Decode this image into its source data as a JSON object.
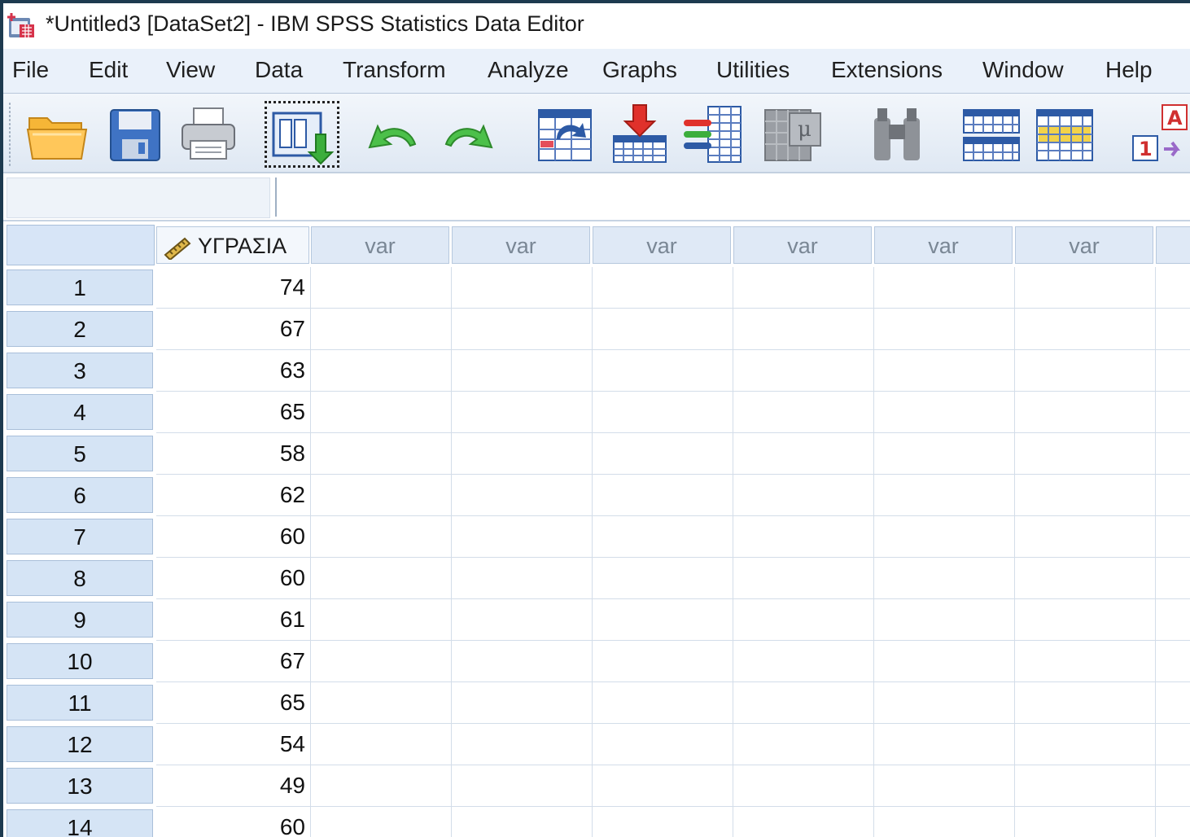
{
  "window": {
    "title": "*Untitled3 [DataSet2] - IBM SPSS Statistics Data Editor"
  },
  "menu": [
    "File",
    "Edit",
    "View",
    "Data",
    "Transform",
    "Analyze",
    "Graphs",
    "Utilities",
    "Extensions",
    "Window",
    "Help"
  ],
  "toolbar": [
    {
      "name": "open-data-document-icon"
    },
    {
      "name": "save-document-icon"
    },
    {
      "name": "print-icon"
    },
    {
      "name": "recall-dialog-icon"
    },
    {
      "name": "undo-icon"
    },
    {
      "name": "redo-icon"
    },
    {
      "name": "go-to-case-icon"
    },
    {
      "name": "go-to-variable-icon"
    },
    {
      "name": "variables-icon"
    },
    {
      "name": "run-descriptives-icon"
    },
    {
      "name": "find-icon"
    },
    {
      "name": "insert-cases-icon"
    },
    {
      "name": "insert-variable-icon"
    },
    {
      "name": "value-labels-icon"
    }
  ],
  "cell_editor": {
    "reference": "",
    "value": ""
  },
  "grid": {
    "columns": [
      "ΥΓΡΑΣΙΑ",
      "var",
      "var",
      "var",
      "var",
      "var",
      "var"
    ],
    "rows": [
      {
        "num": "1",
        "value": "74"
      },
      {
        "num": "2",
        "value": "67"
      },
      {
        "num": "3",
        "value": "63"
      },
      {
        "num": "4",
        "value": "65"
      },
      {
        "num": "5",
        "value": "58"
      },
      {
        "num": "6",
        "value": "62"
      },
      {
        "num": "7",
        "value": "60"
      },
      {
        "num": "8",
        "value": "60"
      },
      {
        "num": "9",
        "value": "61"
      },
      {
        "num": "10",
        "value": "67"
      },
      {
        "num": "11",
        "value": "65"
      },
      {
        "num": "12",
        "value": "54"
      },
      {
        "num": "13",
        "value": "49"
      },
      {
        "num": "14",
        "value": "60"
      }
    ]
  }
}
